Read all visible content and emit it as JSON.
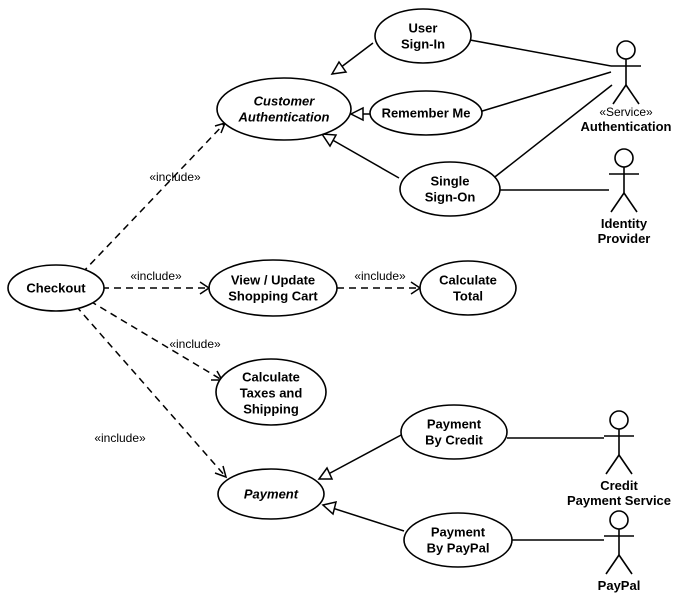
{
  "usecases": {
    "checkout": "Checkout",
    "custauth_l1": "Customer",
    "custauth_l2": "Authentication",
    "signin_l1": "User",
    "signin_l2": "Sign-In",
    "remember": "Remember Me",
    "sso_l1": "Single",
    "sso_l2": "Sign-On",
    "cart_l1": "View / Update",
    "cart_l2": "Shopping Cart",
    "total_l1": "Calculate",
    "total_l2": "Total",
    "tax_l1": "Calculate",
    "tax_l2": "Taxes and",
    "tax_l3": "Shipping",
    "payment": "Payment",
    "paycredit_l1": "Payment",
    "paycredit_l2": "By Credit",
    "paypaypal_l1": "Payment",
    "paypaypal_l2": "By PayPal"
  },
  "labels": {
    "include1": "«include»",
    "include2": "«include»",
    "include3": "«include»",
    "include4": "«include»",
    "include5": "«include»"
  },
  "actors": {
    "auth_stereo": "«Service»",
    "auth": "Authentication",
    "idp_l1": "Identity",
    "idp_l2": "Provider",
    "credit_l1": "Credit",
    "credit_l2": "Payment Service",
    "paypal": "PayPal"
  }
}
